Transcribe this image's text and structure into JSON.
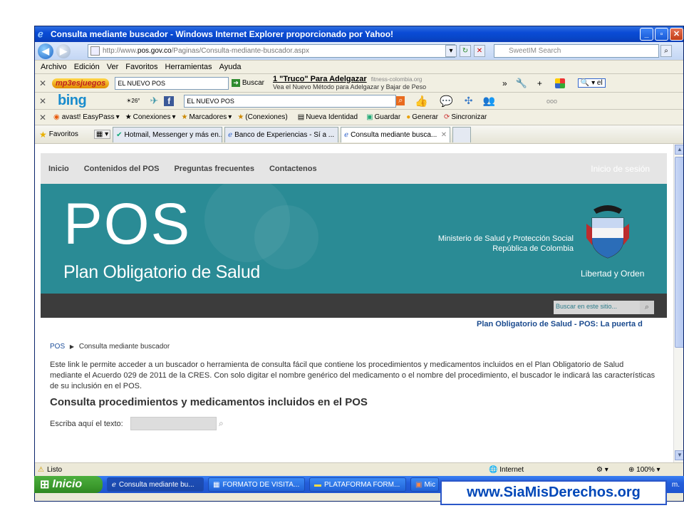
{
  "window": {
    "title": "Consulta mediante buscador - Windows Internet Explorer proporcionado por Yahoo!",
    "controls": [
      "_",
      "▫",
      "✕"
    ]
  },
  "address": {
    "prefix": "http://www.",
    "domain": "pos.gov.co",
    "path": "/Paginas/Consulta-mediante-buscador.aspx",
    "search_placeholder": "SweetIM Search"
  },
  "menu": [
    "Archivo",
    "Edición",
    "Ver",
    "Favoritos",
    "Herramientas",
    "Ayuda"
  ],
  "toolbar1": {
    "brand": "mp3esjuegos",
    "search_value": "EL NUEVO POS",
    "buscar": "Buscar",
    "ad_title": "1 \"Truco\" Para Adelgazar",
    "ad_url": "fitness-colombia.org",
    "ad_text": "Vea el Nuevo Método para Adelgazar y Bajar de Peso"
  },
  "toolbar2": {
    "brand": "bing",
    "temp": "26°",
    "search_value": "EL NUEVO POS"
  },
  "toolbar3": {
    "items": [
      "avast! EasyPass",
      "Conexiones",
      "Marcadores",
      "(Conexiones)",
      "Nueva Identidad",
      "Guardar",
      "Generar",
      "Sincronizar"
    ]
  },
  "favorites": {
    "label": "Favoritos",
    "tabs": [
      "Hotmail, Messenger y más en...",
      "Banco de Experiencias - Sí a ...",
      "Consulta mediante busca..."
    ]
  },
  "site": {
    "nav": [
      "Inicio",
      "Contenidos del POS",
      "Preguntas frecuentes",
      "Contactenos"
    ],
    "login": "Inicio de sesión",
    "hero_big": "POS",
    "hero_sub": "Plan Obligatorio de Salud",
    "ministry_1": "Ministerio de Salud y Protección Social",
    "ministry_2": "República de Colombia",
    "motto": "Libertad y Orden",
    "search_placeholder": "Buscar en este sitio...",
    "marquee": "Plan Obligatorio de Salud - POS: La puerta d",
    "breadcrumb_root": "POS",
    "breadcrumb_current": "Consulta mediante buscador",
    "intro": "Este link le permite acceder a un buscador o herramienta de consulta fácil que contiene los procedimientos y medicamentos incluidos en el Plan Obligatorio de Salud mediante el Acuerdo 029 de 2011 de la CRES. Con solo digitar el nombre genérico del medicamento o el nombre del procedimiento, el buscador le indicará las características de su inclusión en el POS.",
    "heading": "Consulta procedimientos y medicamentos incluidos en el POS",
    "query_label": "Escriba aquí el texto:"
  },
  "status": {
    "text": "Listo",
    "zone": "Internet",
    "zoom": "100%"
  },
  "taskbar": {
    "start": "Inicio",
    "tasks": [
      "Consulta mediante bu...",
      "FORMATO DE VISITA...",
      "PLATAFORMA FORM...",
      "Mic"
    ],
    "clock_tail": "m."
  },
  "brand_overlay": "www.SiaMisDerechos.org",
  "colors": {
    "hero": "#2a8b95",
    "xp_blue": "#245edb",
    "start_green": "#3c9a2d"
  }
}
